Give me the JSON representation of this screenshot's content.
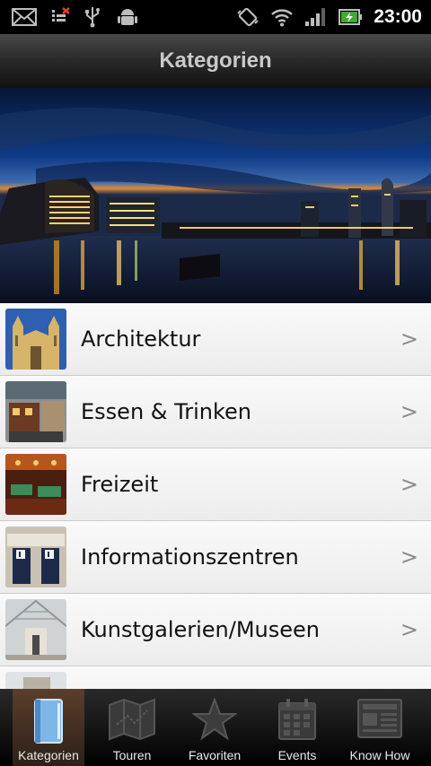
{
  "status_bar": {
    "time": "23:00"
  },
  "header": {
    "title": "Kategorien"
  },
  "categories": [
    {
      "label": "Architektur",
      "chevron": ">"
    },
    {
      "label": "Essen & Trinken",
      "chevron": ">"
    },
    {
      "label": "Freizeit",
      "chevron": ">"
    },
    {
      "label": "Informationszentren",
      "chevron": ">"
    },
    {
      "label": "Kunstgalerien/Museen",
      "chevron": ">"
    }
  ],
  "tabs": [
    {
      "label": "Kategorien",
      "icon": "book-icon",
      "active": true
    },
    {
      "label": "Touren",
      "icon": "map-icon",
      "active": false
    },
    {
      "label": "Favoriten",
      "icon": "star-icon",
      "active": false
    },
    {
      "label": "Events",
      "icon": "calendar-icon",
      "active": false
    },
    {
      "label": "Know How",
      "icon": "newspaper-icon",
      "active": false
    }
  ]
}
